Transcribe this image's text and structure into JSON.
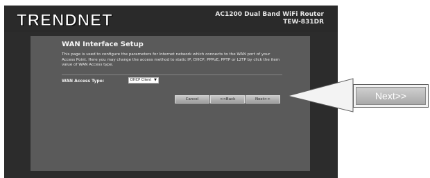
{
  "header": {
    "logo": "TRENDNET",
    "product_line1": "AC1200 Dual Band WiFi Router",
    "product_line2": "TEW-831DR"
  },
  "panel": {
    "title": "WAN Interface Setup",
    "description": "This page is used to configure the parameters for Internet network which connects to the WAN port of your Access Point. Here you may change the access method to static IP, DHCP, PPPoE, PPTP or L2TP by click the item value of WAN Access type.",
    "wan_access_label": "WAN Access Type:",
    "wan_access_value": "DHCP Client"
  },
  "buttons": {
    "cancel": "Cancel",
    "back": "<<Back",
    "next": "Next>>"
  },
  "callout": {
    "label": "Next>>"
  },
  "colors": {
    "frame_bg": "#2c2c2c",
    "panel_bg": "#5a5a5a",
    "button_bg": "#b3b3b3"
  }
}
